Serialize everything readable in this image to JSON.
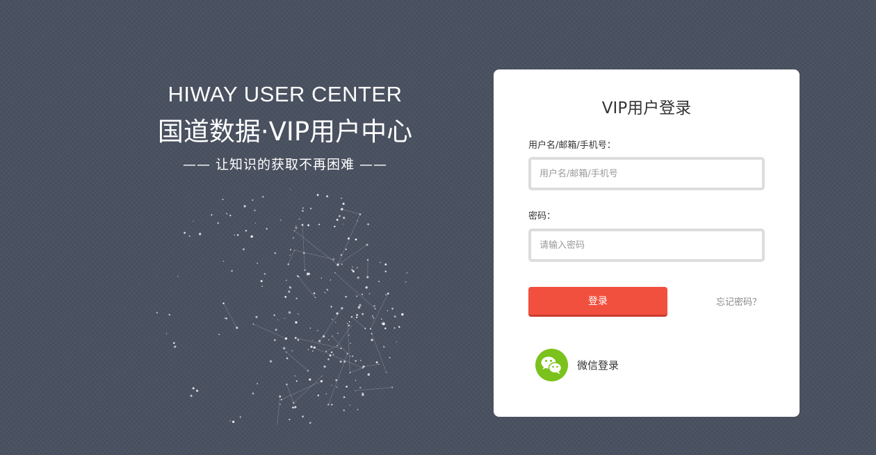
{
  "hero": {
    "title_en": "HIWAY USER CENTER",
    "title_cn": "国道数据·VIP用户中心",
    "slogan": "—— 让知识的获取不再困难 ——"
  },
  "login": {
    "title": "VIP用户登录",
    "username_label": "用户名/邮箱/手机号：",
    "username_placeholder": "用户名/邮箱/手机号",
    "password_label": "密码：",
    "password_placeholder": "请输入密码",
    "submit_label": "登录",
    "forgot_label": "忘记密码？",
    "wechat_label": "微信登录",
    "wechat_icon": "wechat-icon"
  },
  "colors": {
    "background": "#4a5160",
    "card": "#ffffff",
    "accent": "#f2503f",
    "wechat": "#7bc21c"
  }
}
